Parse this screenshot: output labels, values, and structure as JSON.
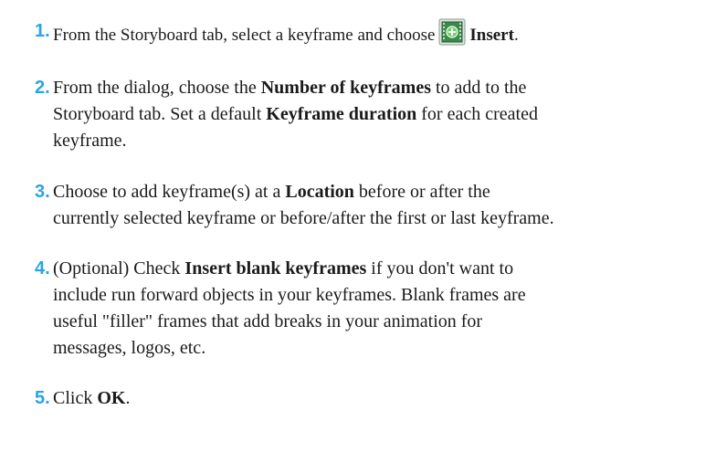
{
  "steps": [
    {
      "number": "1.",
      "lines": [
        {
          "pre": "From the Storyboard tab, select a keyframe and choose",
          "icon": "insert-keyframe-icon",
          "bold": "Insert",
          "post": "."
        }
      ]
    },
    {
      "number": "2.",
      "lines": [
        {
          "pre": "From the dialog, choose the ",
          "bold": "Number of keyframes",
          "post": " to add to the"
        },
        {
          "pre": "Storyboard tab. Set a default ",
          "bold": "Keyframe duration",
          "post": " for each created"
        },
        {
          "pre": "keyframe.",
          "bold": "",
          "post": ""
        }
      ]
    },
    {
      "number": "3.",
      "lines": [
        {
          "pre": "Choose to add keyframe(s) at a ",
          "bold": "Location",
          "post": " before or after the"
        },
        {
          "pre": "currently selected keyframe or before/after the first or last keyframe.",
          "bold": "",
          "post": ""
        }
      ]
    },
    {
      "number": "4.",
      "lines": [
        {
          "pre": "(Optional) Check ",
          "bold": "Insert blank keyframes",
          "post": " if you don't want to"
        },
        {
          "pre": "include run forward objects in your keyframes. Blank frames are",
          "bold": "",
          "post": ""
        },
        {
          "pre": "useful \"filler\" frames that add breaks in your animation for",
          "bold": "",
          "post": ""
        },
        {
          "pre": "messages, logos, etc.",
          "bold": "",
          "post": ""
        }
      ]
    },
    {
      "number": "5.",
      "lines": [
        {
          "pre": "Click ",
          "bold": "OK",
          "post": "."
        }
      ]
    }
  ],
  "colors": {
    "step_number": "#29a4e6",
    "icon_frame": "#3a8a4a",
    "icon_plus": "#6fd06a"
  }
}
